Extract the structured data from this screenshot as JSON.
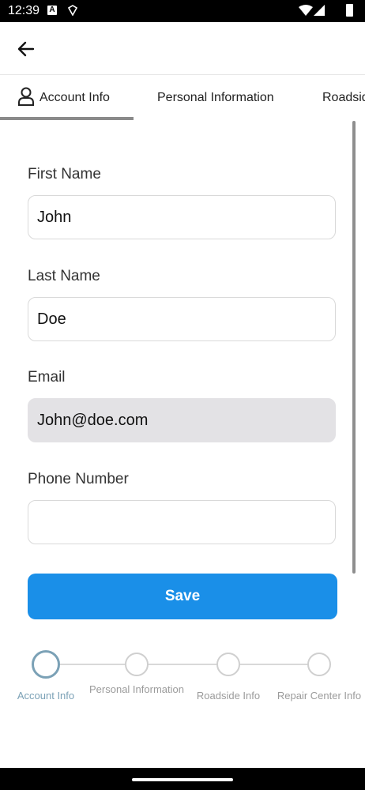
{
  "status_bar": {
    "time": "12:39",
    "a_badge": "A"
  },
  "tabs": [
    {
      "label": "Account Info"
    },
    {
      "label": "Personal Information"
    },
    {
      "label": "Roadside Info"
    }
  ],
  "form": {
    "first_name": {
      "label": "First Name",
      "value": "John"
    },
    "last_name": {
      "label": "Last Name",
      "value": "Doe"
    },
    "email": {
      "label": "Email",
      "value": "John@doe.com"
    },
    "phone": {
      "label": "Phone Number",
      "value": ""
    },
    "save_label": "Save"
  },
  "stepper": [
    {
      "label": "Account Info",
      "active": true
    },
    {
      "label": "Personal Information",
      "active": false
    },
    {
      "label": "Roadside Info",
      "active": false
    },
    {
      "label": "Repair Center Info",
      "active": false
    }
  ],
  "colors": {
    "primary": "#1a8fe8",
    "stepper_active": "#7ba1b6",
    "disabled_field": "#e3e2e5"
  }
}
